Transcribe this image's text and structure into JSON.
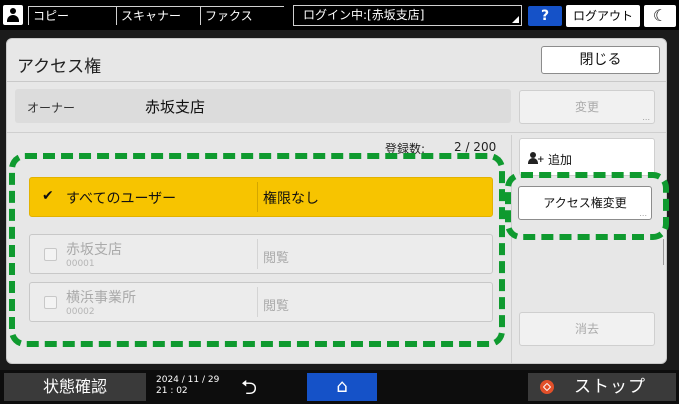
{
  "topbar": {
    "tabs": [
      "コピー",
      "スキャナー",
      "ファクス"
    ],
    "login_status": "ログイン中:[赤坂支店]",
    "help_label": "?",
    "logout_label": "ログアウト",
    "sleep_icon": "moon-icon"
  },
  "panel": {
    "title": "アクセス権",
    "close_label": "閉じる",
    "owner_label": "オーナー",
    "owner_value": "赤坂支店",
    "change_label": "変更",
    "registered_label": "登録数:",
    "registered_value": "2 / 200",
    "add_label": "追加",
    "access_change_label": "アクセス権変更",
    "delete_label": "消去",
    "ellipsis": "..."
  },
  "entries": [
    {
      "name": "すべてのユーザー",
      "id": "",
      "permission": "権限なし",
      "selected": true
    },
    {
      "name": "赤坂支店",
      "id": "00001",
      "permission": "閲覧",
      "selected": false
    },
    {
      "name": "横浜事業所",
      "id": "00002",
      "permission": "閲覧",
      "selected": false
    }
  ],
  "bottombar": {
    "status_label": "状態確認",
    "date": "2024 / 11 / 29",
    "time": "21 : 02",
    "stop_label": "ストップ"
  },
  "colors": {
    "selected_row": "#f7c400",
    "highlight": "#0f9a2f",
    "accent_blue": "#1552c8",
    "stop_red": "#e2502a"
  }
}
